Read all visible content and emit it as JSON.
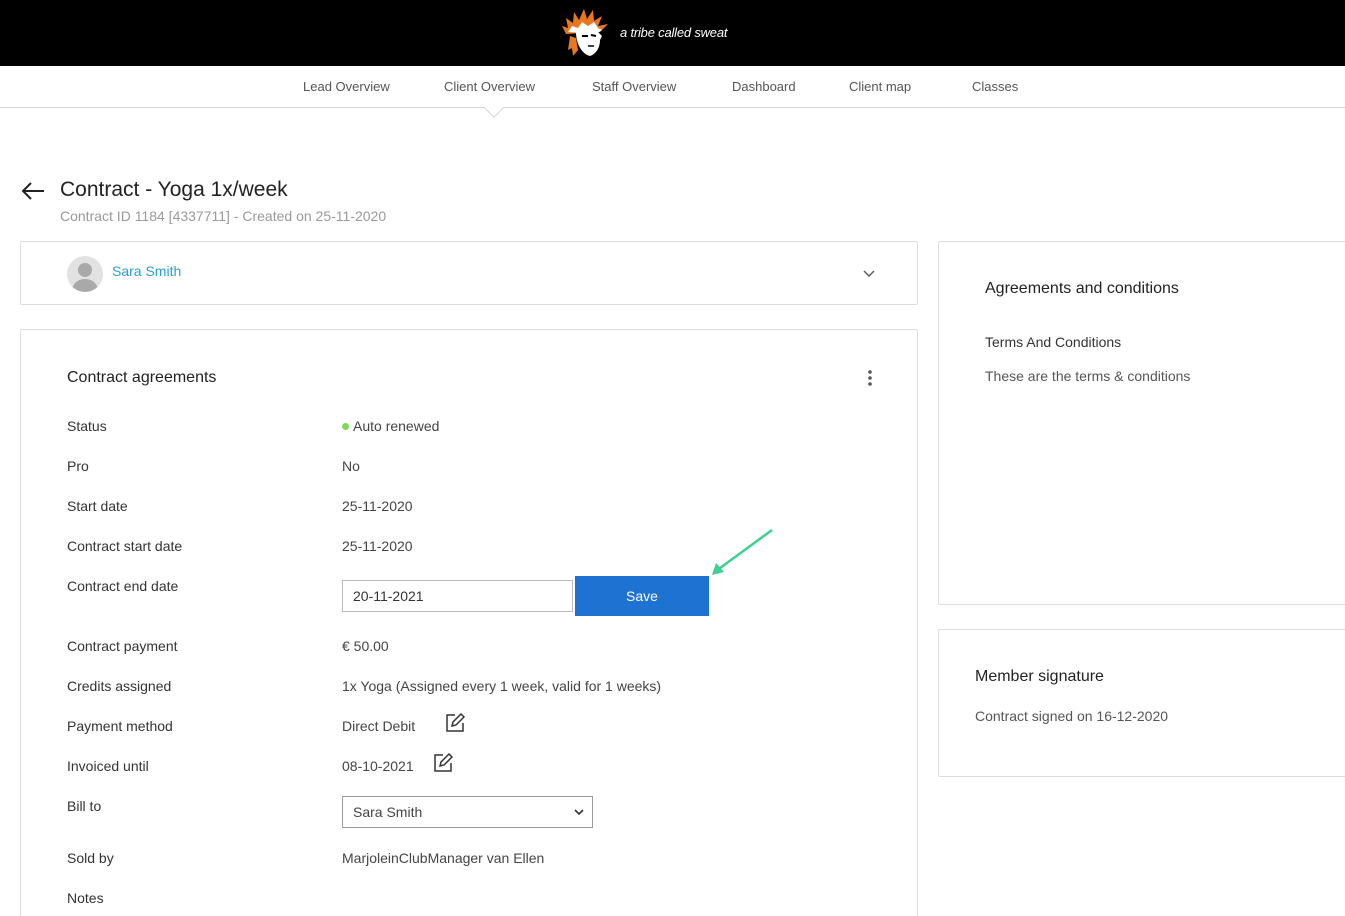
{
  "brand": {
    "name": "a tribe called sweat"
  },
  "nav": {
    "items": [
      {
        "label": "Lead Overview"
      },
      {
        "label": "Client Overview"
      },
      {
        "label": "Staff Overview"
      },
      {
        "label": "Dashboard"
      },
      {
        "label": "Client map"
      },
      {
        "label": "Classes"
      }
    ],
    "active": "Client Overview"
  },
  "header": {
    "title": "Contract - Yoga 1x/week",
    "subtitle": "Contract ID 1184 [4337711] - Created on 25-11-2020"
  },
  "client": {
    "name": "Sara Smith"
  },
  "agreements": {
    "title": "Contract agreements",
    "rows": [
      {
        "label": "Status",
        "value": "Auto renewed"
      },
      {
        "label": "Pro",
        "value": "No"
      },
      {
        "label": "Start date",
        "value": "25-11-2020"
      },
      {
        "label": "Contract start date",
        "value": "25-11-2020"
      },
      {
        "label": "Contract end date",
        "value": "20-11-2021"
      },
      {
        "label": "Contract payment",
        "value": "€ 50.00"
      },
      {
        "label": "Credits assigned",
        "value": "1x Yoga (Assigned every 1 week, valid for 1 weeks)"
      },
      {
        "label": "Payment method",
        "value": "Direct Debit"
      },
      {
        "label": "Invoiced until",
        "value": "08-10-2021"
      },
      {
        "label": "Bill to",
        "value": "Sara Smith"
      },
      {
        "label": "Sold by",
        "value": "MarjoleinClubManager van Ellen"
      },
      {
        "label": "Notes",
        "value": ""
      }
    ],
    "save_label": "Save"
  },
  "terms": {
    "title": "Agreements and conditions",
    "subtitle": "Terms And Conditions",
    "text": "These are the terms & conditions"
  },
  "signature": {
    "title": "Member signature",
    "text": "Contract signed on 16-12-2020"
  },
  "colors": {
    "topbar": "#000000",
    "link": "#2a9fd6",
    "primary_button": "#1e73d2",
    "status_dot": "#7ed957",
    "annotation_arrow": "#3fcf8e"
  },
  "icons": [
    "back-arrow-icon",
    "chevron-down-icon",
    "kebab-menu-icon",
    "edit-icon",
    "status-dot-icon",
    "logo-icon"
  ]
}
